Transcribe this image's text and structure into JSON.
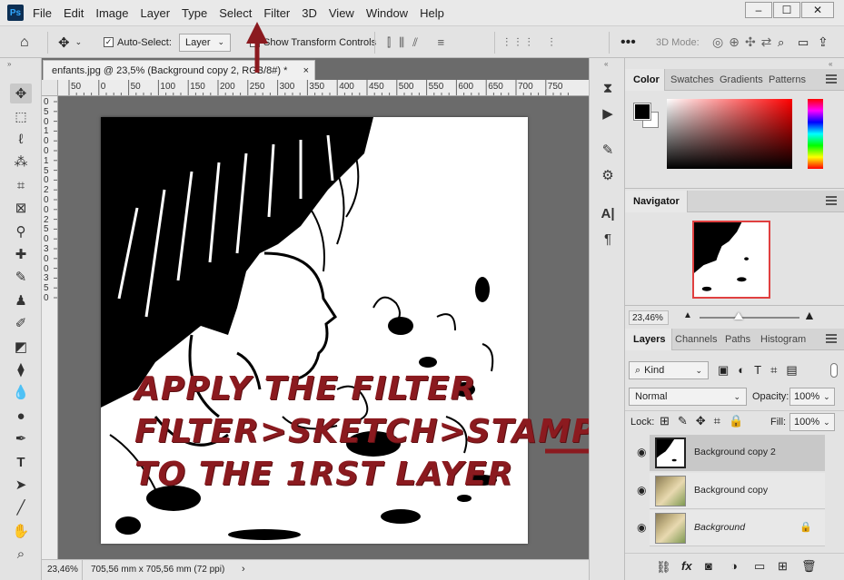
{
  "menubar": {
    "logo": "Ps",
    "items": [
      "File",
      "Edit",
      "Image",
      "Layer",
      "Type",
      "Select",
      "Filter",
      "3D",
      "View",
      "Window",
      "Help"
    ],
    "window_controls": [
      "–",
      "☐",
      "✕"
    ]
  },
  "optionsbar": {
    "auto_select_label": "Auto-Select:",
    "auto_select_value": "Layer",
    "show_transform_label": "Show Transform Controls",
    "mode_3d_label": "3D Mode:"
  },
  "document": {
    "tab_title": "enfants.jpg @ 23,5% (Background copy 2, RGB/8#) *",
    "ruler_h": [
      "50",
      "0",
      "50",
      "100",
      "150",
      "200",
      "250",
      "300",
      "350",
      "400",
      "450",
      "500",
      "550",
      "600",
      "650",
      "700",
      "750"
    ],
    "ruler_v": [
      "0",
      "5",
      "0",
      "1",
      "0",
      "0",
      "1",
      "5",
      "0",
      "2",
      "0",
      "0",
      "2",
      "5",
      "0",
      "3",
      "0",
      "0",
      "3",
      "5",
      "0"
    ],
    "zoom": "23,46%",
    "doc_size": "705,56 mm x 705,56 mm (72 ppi)"
  },
  "annotation": {
    "lines": [
      "APPLY THE FILTER",
      "FILTER>SKETCH>STAMP",
      "TO THE 1RST LAYER"
    ],
    "color": "#8b1a1f"
  },
  "color_panel": {
    "tabs": [
      "Color",
      "Swatches",
      "Gradients",
      "Patterns"
    ]
  },
  "navigator_panel": {
    "title": "Navigator",
    "zoom": "23,46%"
  },
  "layers_panel": {
    "tabs": [
      "Layers",
      "Channels",
      "Paths",
      "Histogram"
    ],
    "filter_kind": "Kind",
    "blend_mode": "Normal",
    "opacity_label": "Opacity:",
    "opacity_value": "100%",
    "lock_label": "Lock:",
    "fill_label": "Fill:",
    "fill_value": "100%",
    "layers": [
      {
        "name": "Background copy 2",
        "selected": true
      },
      {
        "name": "Background copy",
        "selected": false
      },
      {
        "name": "Background",
        "selected": false,
        "locked": true
      }
    ],
    "footer_icons": [
      "link-icon",
      "fx-icon",
      "mask-icon",
      "adjustment-icon",
      "group-icon",
      "new-layer-icon",
      "trash-icon"
    ]
  }
}
